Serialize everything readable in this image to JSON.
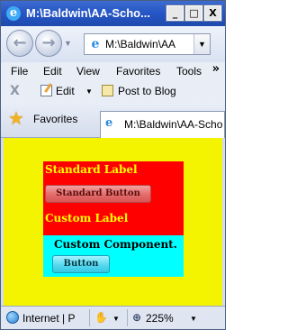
{
  "window": {
    "title": "M:\\Baldwin\\AA-Scho...",
    "minimize_glyph": "_",
    "maximize_glyph": "□",
    "close_glyph": "X"
  },
  "nav": {
    "back_glyph": "←",
    "forward_glyph": "→",
    "address": "M:\\Baldwin\\AA"
  },
  "menu": {
    "items": [
      "File",
      "Edit",
      "View",
      "Favorites",
      "Tools"
    ],
    "overflow": "»"
  },
  "command_bar": {
    "stop_glyph": "X",
    "edit_label": "Edit",
    "post_label": "Post to Blog"
  },
  "favorites": {
    "label": "Favorites",
    "tab_title": "M:\\Baldwin\\AA-Scho"
  },
  "content": {
    "standard_label": "Standard Label",
    "standard_button": "Standard Button",
    "custom_label": "Custom Label",
    "custom_component": "Custom Component.",
    "custom_button": "Button",
    "colors": {
      "page": "#f4f400",
      "panel": "#ff0000",
      "custom_panel": "#00ffff",
      "label_text": "#ffff00"
    }
  },
  "status": {
    "zone": "Internet | P",
    "zoom": "225%"
  },
  "icons": [
    "ie-icon",
    "back-arrow-icon",
    "forward-arrow-icon",
    "page-icon",
    "dropdown-icon",
    "stop-icon",
    "edit-icon",
    "blog-icon",
    "star-icon",
    "tab-page-icon",
    "globe-icon",
    "protected-mode-icon",
    "zoom-icon"
  ]
}
